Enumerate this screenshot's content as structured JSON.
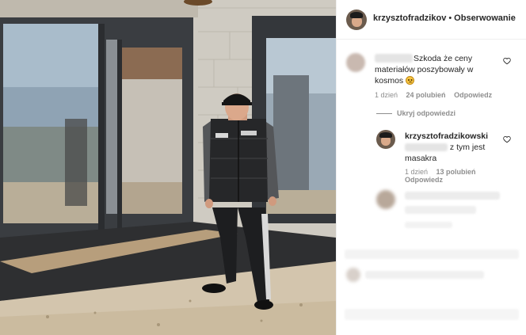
{
  "post": {
    "photo_alt": "Man in black vest standing in front of large glass windows of a house under construction"
  },
  "header": {
    "username": "krzysztofradzikov",
    "separator": "•",
    "follow_label": "Obserwowanie"
  },
  "comments": [
    {
      "username_redacted": true,
      "text_line1": "Szkoda że ceny",
      "text_line2": "materiałów poszybowały w",
      "text_line3": "kosmos",
      "emoji": "sad-face",
      "time": "1 dzień",
      "likes": "24 polubień",
      "reply_label": "Odpowiedz",
      "toggle_replies": "Ukryj odpowiedzi",
      "replies": [
        {
          "username": "krzysztofradzikowski",
          "text_tail": "z tym jest",
          "text_line2": "masakra",
          "time": "1 dzień",
          "likes": "13 polubień",
          "reply_label": "Odpowiedz"
        }
      ]
    }
  ],
  "colors": {
    "text": "#262626",
    "meta": "#8e8e8e",
    "divider": "#efefef"
  }
}
